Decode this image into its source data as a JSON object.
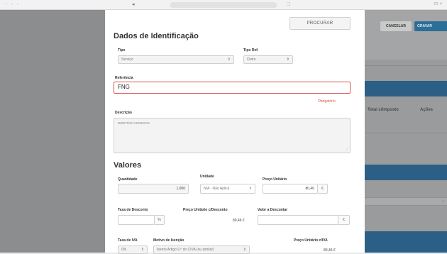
{
  "browser": {
    "tab_dots": "··· ◦ ◦",
    "back_arrow": "◂",
    "url": "",
    "share_icon": "⬚",
    "right_icons": "⊡ +"
  },
  "background": {
    "cancel_label": "CANCELAR",
    "save_label": "GRAVAR",
    "col_total": "Total c/Imposto",
    "col_actions": "Ações"
  },
  "modal": {
    "search_button": "PROCURAR",
    "identification_title": "Dados de Identificação",
    "tipo_label": "Tipo",
    "tipo_value": "Serviço",
    "tipo_ref_label": "Tipo Ref.",
    "tipo_ref_value": "Outro",
    "referencia_label": "Referência",
    "referencia_value": "FNG",
    "obrigatorio": "Obrigatório",
    "descricao_label": "Descrição",
    "descricao_value": "DIREITOS CONEXOS",
    "values_title": "Valores",
    "quantidade_label": "Quantidade",
    "quantidade_value": "1,000",
    "unidade_label": "Unidade",
    "unidade_value": "N/A - Não Aplicá",
    "preco_unit_label": "Preço Unitário",
    "preco_unit_value": "80,46",
    "currency": "€",
    "taxa_desc_label": "Taxa de Desconto",
    "percent": "%",
    "preco_desc_label": "Preço Unitário c/Desconto",
    "preco_desc_value": "80,46 €",
    "valor_desc_label": "Valor a Descontar",
    "taxa_iva_label": "Taxa de IVA",
    "taxa_iva_value": "0%",
    "motivo_label": "Motivo de Isenção",
    "motivo_value": "Isento Artigo 9.º do CIVA (ou similar)",
    "preco_iva_label": "Preço Unitário c/IVA",
    "preco_iva_value": "80,46 €"
  }
}
